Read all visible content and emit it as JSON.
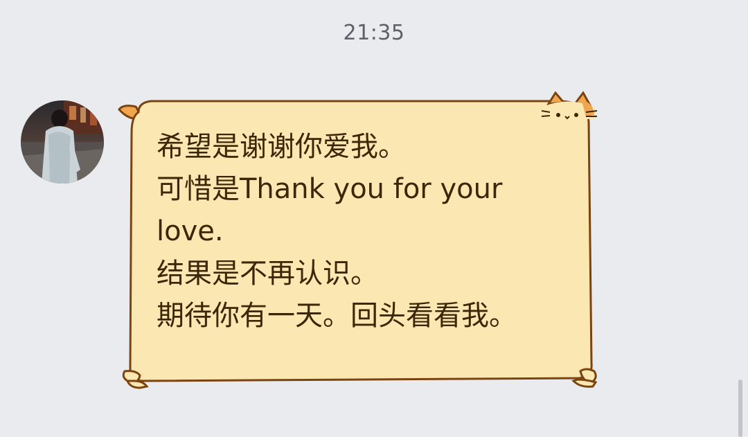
{
  "timestamp": "21:35",
  "message": {
    "sender": "contact",
    "text": "希望是谢谢你爱我。\n可惜是Thank you for your love.\n结果是不再认识。\n期待你有一天。回头看看我。"
  },
  "bubble": {
    "style": "cat-sticker-bubble",
    "fill_color": "#fbe7b1",
    "border_color": "#7a4310",
    "decoration_icons": [
      "cat-ear-left-icon",
      "cat-face-top-right-icon",
      "paw-corner-icons"
    ]
  },
  "avatar": {
    "icon": "contact-avatar-photo"
  }
}
